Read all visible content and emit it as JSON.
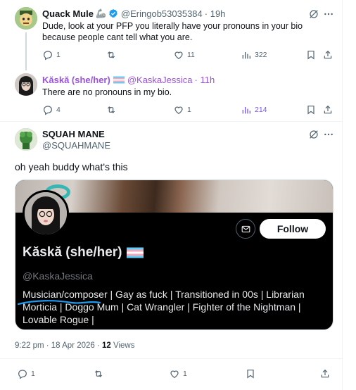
{
  "tweets": [
    {
      "author": "Quack Mule",
      "emoji": "🦾",
      "handle": "@Eringob53035384",
      "time": "· 19h",
      "text": "Dude, look at your PFP you literally have your pronouns in your bio because people cant tell what you are.",
      "replies": "1",
      "likes": "11",
      "views": "322"
    },
    {
      "author": "Kăskă (she/her)",
      "handle": "@KaskaJessica",
      "time": "· 11h",
      "text": "There are no pronouns in my bio.",
      "replies": "4",
      "likes": "1",
      "views": "214"
    }
  ],
  "main_tweet": {
    "author": "SQUAH MANE",
    "handle": "@SQUAHMANE",
    "text": "oh yeah buddy what's this",
    "card": {
      "name": "Kăskă (she/her)",
      "handle": "@KaskaJessica",
      "follow_label": "Follow",
      "bio": "Musician/composer | Gay as fuck | Transitioned in 00s | Librarian Morticia | Doggo Mum | Cat Wrangler | Fighter of the Nightman | Lovable Rogue |"
    },
    "timestamp": "9:22 pm · 18 Apr 2026 · ",
    "views_count": "12",
    "views_label": " Views",
    "replies": "1",
    "likes": "1"
  },
  "colors": {
    "accent": "#1d9bf0",
    "views_highlight": "#7856ff",
    "handle_purple": "#9b51e0",
    "text_secondary": "#536471"
  },
  "icons": [
    "verified-badge-icon",
    "grok-icon",
    "more-icon",
    "reply-icon",
    "retweet-icon",
    "like-icon",
    "views-icon",
    "bookmark-icon",
    "share-icon",
    "message-icon",
    "trans-flag-icon"
  ]
}
